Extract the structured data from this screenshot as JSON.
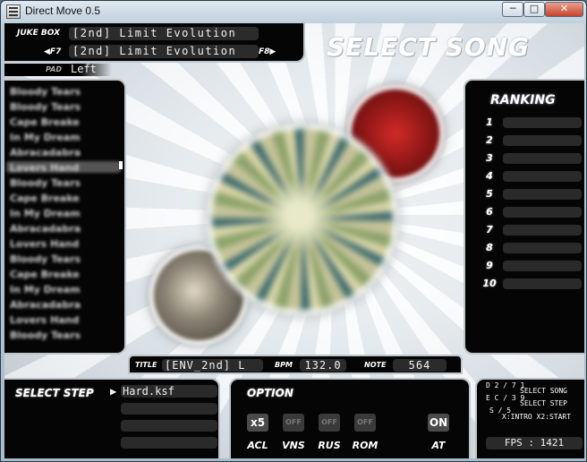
{
  "window": {
    "title": "Direct Move 0.5",
    "min_label": "─",
    "max_label": "□",
    "close_label": "✕"
  },
  "header": {
    "jukebox_label": "JUKE BOX",
    "jukebox_value": "[2nd] Limit Evolution",
    "prev_key": "◀F7",
    "next_key": "F8▶",
    "current_value": "[2nd] Limit Evolution",
    "pad_label": "PAD",
    "pad_value": "Left",
    "screen_title": "SELECT SONG"
  },
  "song_list": {
    "items": [
      "Bloody Tears",
      "Bloody Tears",
      "Cape Breake",
      "In My Dream",
      "Abracadabra",
      "Lovers Hand",
      "Bloody Tears",
      "Cape Breake",
      "In My Dream",
      "Abracadabra",
      "Lovers Hand",
      "Bloody Tears",
      "Cape Breake",
      "In My Dream",
      "Abracadabra",
      "Lovers Hand",
      "Bloody Tears"
    ],
    "selected_index": 5
  },
  "ranking": {
    "title": "RANKING",
    "ranks": [
      "1",
      "2",
      "3",
      "4",
      "5",
      "6",
      "7",
      "8",
      "9",
      "10"
    ]
  },
  "info_bar": {
    "title_label": "TITLE",
    "title_value": "[ENV_2nd] L",
    "bpm_label": "BPM",
    "bpm_value": "132.0",
    "note_label": "NOTE",
    "note_value": "564"
  },
  "select_step": {
    "label": "SELECT STEP",
    "arrow": "▶",
    "value": "Hard.ksf"
  },
  "option": {
    "label": "OPTION",
    "speed": "x5",
    "vns": "OFF",
    "rus": "OFF",
    "rom": "OFF",
    "at": "ON",
    "labels": {
      "acl": "ACL",
      "vns": "VNS",
      "rus": "RUS",
      "rom": "ROM",
      "at": "AT"
    }
  },
  "status": {
    "line1": "D 2 / 7 1",
    "line2": "E C / 3 9",
    "line3": "S / 5",
    "hint_song": "SELECT SONG",
    "hint_step": "SELECT STEP",
    "hint_keys": "X:INTRO X2:START",
    "fps_label": "FPS : 1421"
  }
}
